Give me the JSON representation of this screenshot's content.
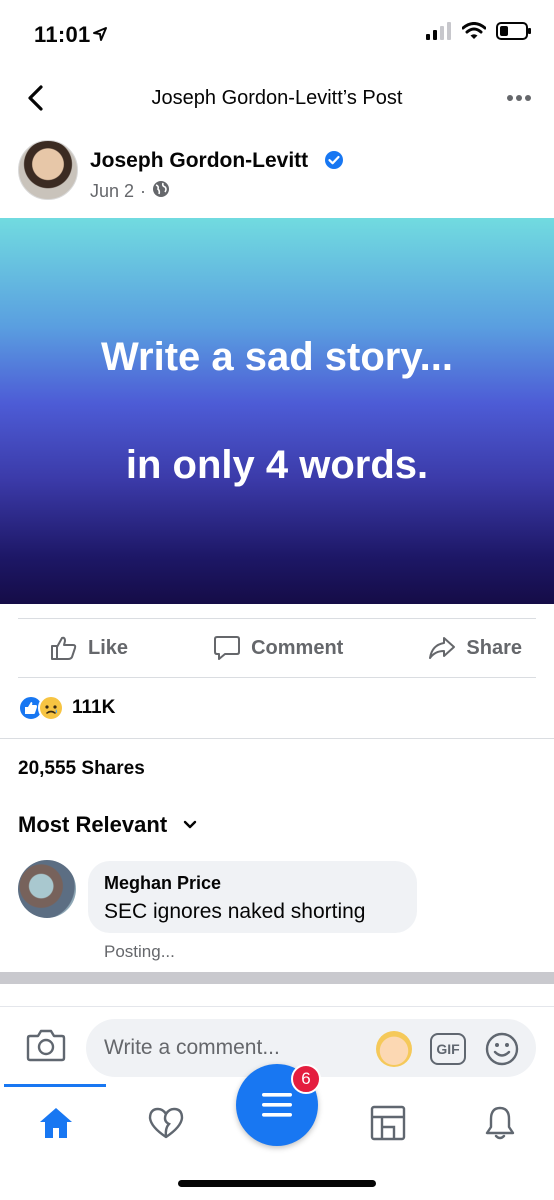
{
  "status_bar": {
    "time": "11:01",
    "icons": [
      "location-arrow-icon",
      "cellular-signal-icon",
      "wifi-icon",
      "battery-icon"
    ]
  },
  "header": {
    "title": "Joseph Gordon-Levitt’s Post",
    "back_icon": "back-chevron-icon",
    "more_icon": "more-dots-icon"
  },
  "post": {
    "author": "Joseph Gordon-Levitt",
    "verified": true,
    "date": "Jun 2",
    "separator": "·",
    "privacy_icon": "globe-icon",
    "text_line1": "Write a sad story...",
    "text_line2": "in only 4 words.",
    "gradient_colors": [
      "#71dbe0",
      "#4d5cd6",
      "#150c47"
    ]
  },
  "actions": {
    "like": "Like",
    "comment": "Comment",
    "share": "Share"
  },
  "reactions": {
    "types": [
      "like",
      "sad"
    ],
    "count": "111K"
  },
  "shares": {
    "label": "20,555 Shares"
  },
  "comments": {
    "sort_label": "Most Relevant",
    "items": [
      {
        "author": "Meghan Price",
        "text": "SEC ignores naked shorting",
        "status": "Posting..."
      }
    ]
  },
  "composer": {
    "placeholder": "Write a comment...",
    "gif_label": "GIF"
  },
  "tab_bar": {
    "tabs": [
      "home-icon",
      "dating-heart-icon",
      "menu-icon",
      "marketplace-icon",
      "notifications-bell-icon"
    ],
    "menu_badge": "6",
    "active_tab": "home"
  },
  "colors": {
    "brand_blue": "#1877f2",
    "badge_red": "#e41e3f",
    "secondary_text": "#65676b"
  }
}
